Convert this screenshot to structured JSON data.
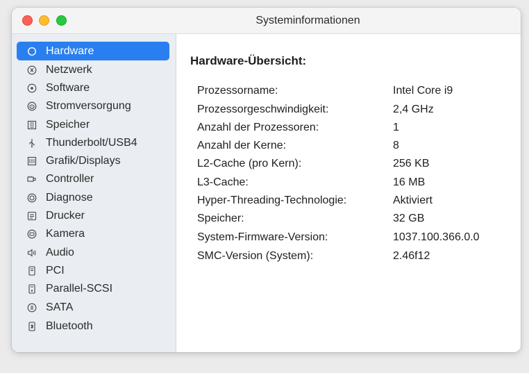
{
  "window": {
    "title": "Systeminformationen"
  },
  "sidebar": {
    "items": [
      {
        "label": "Hardware",
        "icon": "circle-icon",
        "selected": true
      },
      {
        "label": "Netzwerk",
        "icon": "network-icon"
      },
      {
        "label": "Software",
        "icon": "software-icon"
      },
      {
        "label": "Stromversorgung",
        "icon": "power-icon"
      },
      {
        "label": "Speicher",
        "icon": "memory-icon"
      },
      {
        "label": "Thunderbolt/USB4",
        "icon": "usb-icon"
      },
      {
        "label": "Grafik/Displays",
        "icon": "graphics-icon"
      },
      {
        "label": "Controller",
        "icon": "controller-icon"
      },
      {
        "label": "Diagnose",
        "icon": "diagnose-icon"
      },
      {
        "label": "Drucker",
        "icon": "printer-icon"
      },
      {
        "label": "Kamera",
        "icon": "camera-icon"
      },
      {
        "label": "Audio",
        "icon": "speaker-icon"
      },
      {
        "label": "PCI",
        "icon": "pci-icon"
      },
      {
        "label": "Parallel-SCSI",
        "icon": "scsi-icon"
      },
      {
        "label": "SATA",
        "icon": "sata-icon"
      },
      {
        "label": "Bluetooth",
        "icon": "bluetooth-icon"
      }
    ]
  },
  "main": {
    "heading": "Hardware-Übersicht:",
    "rows": [
      {
        "key": "Prozessorname:",
        "value": "Intel Core i9"
      },
      {
        "key": "Prozessorgeschwindigkeit:",
        "value": "2,4 GHz"
      },
      {
        "key": "Anzahl der Prozessoren:",
        "value": "1"
      },
      {
        "key": "Anzahl der Kerne:",
        "value": "8"
      },
      {
        "key": "L2-Cache (pro Kern):",
        "value": "256 KB"
      },
      {
        "key": "L3-Cache:",
        "value": "16 MB"
      },
      {
        "key": "Hyper-Threading-Technologie:",
        "value": "Aktiviert"
      },
      {
        "key": "Speicher:",
        "value": "32 GB"
      },
      {
        "key": "System-Firmware-Version:",
        "value": "1037.100.366.0.0"
      },
      {
        "key": "SMC-Version (System):",
        "value": "2.46f12"
      }
    ]
  },
  "colors": {
    "accent": "#2a7ff0",
    "sidebar_bg": "#eaedf1"
  }
}
